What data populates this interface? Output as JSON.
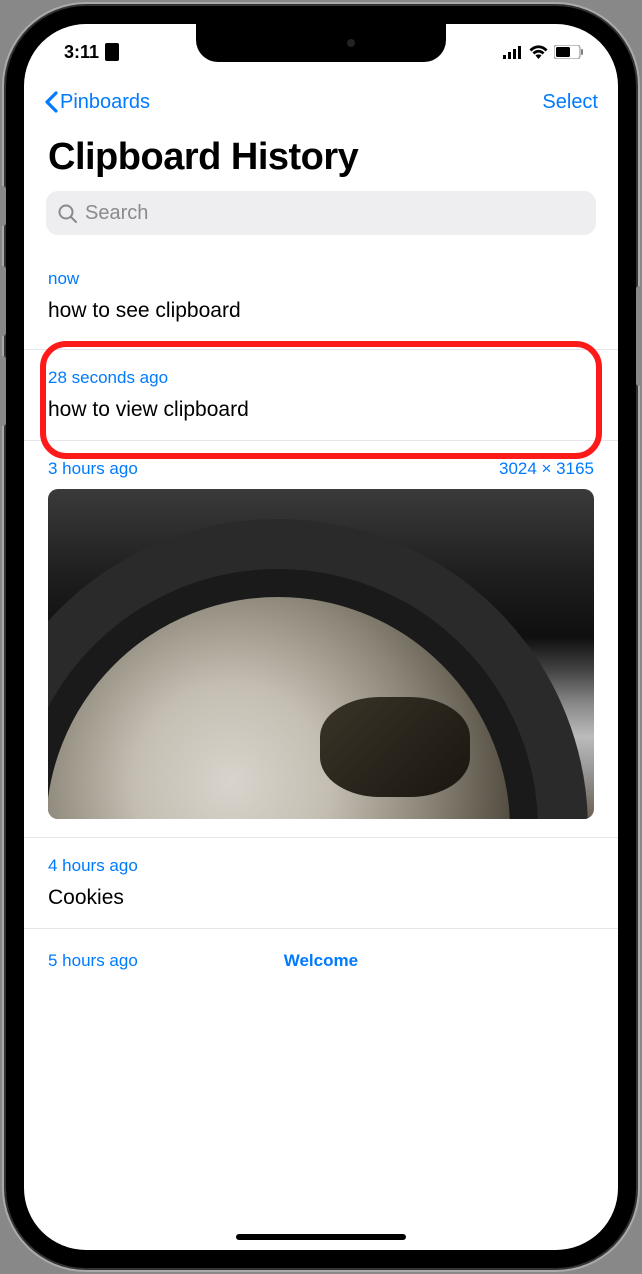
{
  "status_bar": {
    "time": "3:11"
  },
  "nav": {
    "back_label": "Pinboards",
    "select_label": "Select"
  },
  "title": "Clipboard History",
  "search": {
    "placeholder": "Search"
  },
  "entries": [
    {
      "time": "now",
      "text": "how to see clipboard"
    },
    {
      "time": "28 seconds ago",
      "text": "how to view clipboard"
    },
    {
      "time": "3 hours ago",
      "meta": "3024 × 3165"
    },
    {
      "time": "4 hours ago",
      "text": "Cookies"
    },
    {
      "time": "5 hours ago",
      "label": "Welcome"
    }
  ]
}
